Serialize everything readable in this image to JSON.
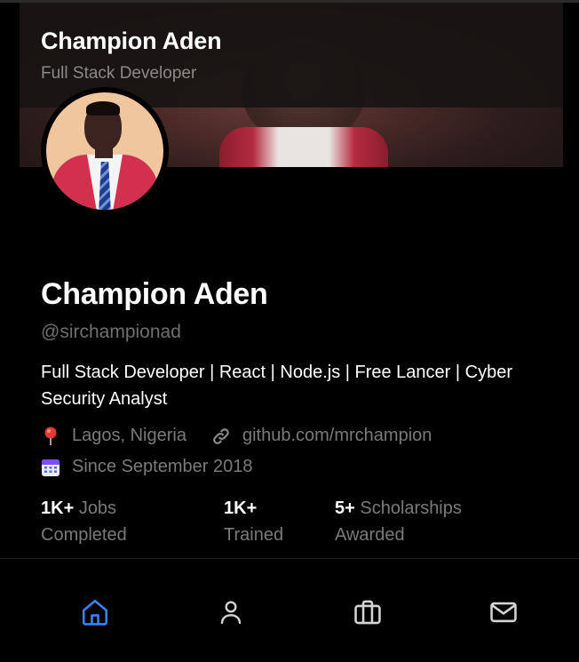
{
  "header": {
    "title": "Champion Aden",
    "subtitle": "Full Stack Developer"
  },
  "profile": {
    "name": "Champion Aden",
    "handle": "@sirchampionad",
    "bio": "Full Stack Developer | React | Node.js | Free Lancer | Cyber Security Analyst",
    "location": "Lagos, Nigeria",
    "website": "github.com/mrchampion",
    "joined": "Since September 2018"
  },
  "stats": [
    {
      "value": "1K+",
      "label_line1": "Jobs",
      "label_line2": "Completed"
    },
    {
      "value": "1K+",
      "label_line1": "",
      "label_line2": "Trained"
    },
    {
      "value": "5+",
      "label_line1": "Scholarships",
      "label_line2": "Awarded"
    }
  ],
  "icons": {
    "location": "pin-icon",
    "website": "link-icon",
    "joined": "calendar-icon"
  },
  "nav": {
    "items": [
      {
        "icon": "home-icon",
        "active": true
      },
      {
        "icon": "user-icon",
        "active": false
      },
      {
        "icon": "briefcase-icon",
        "active": false
      },
      {
        "icon": "mail-icon",
        "active": false
      }
    ]
  },
  "colors": {
    "background": "#000000",
    "accent": "#3b82f6",
    "muted_text": "#7a7a7a",
    "nav_icon": "#d4d4d4"
  }
}
